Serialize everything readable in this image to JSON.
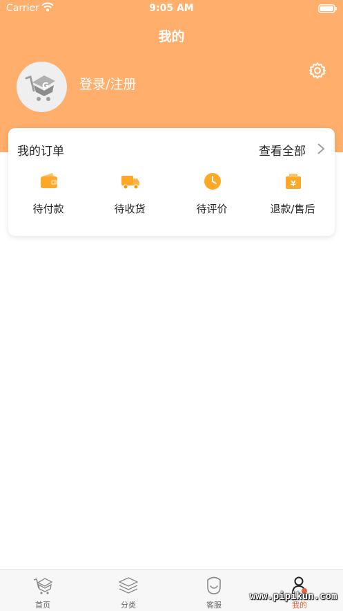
{
  "status_bar": {
    "carrier": "Carrier",
    "time": "9:05 AM",
    "wifi_icon": "wifi-icon",
    "battery_icon": "battery-icon"
  },
  "header": {
    "title": "我的",
    "login_label": "登录/注册",
    "avatar_icon": "logo-cart-icon",
    "settings_icon": "gear-icon"
  },
  "orders": {
    "title": "我的订单",
    "view_all_label": "查看全部",
    "view_all_icon": "chevron-right-icon",
    "items": [
      {
        "label": "待付款",
        "icon": "wallet-icon"
      },
      {
        "label": "待收货",
        "icon": "truck-icon"
      },
      {
        "label": "待评价",
        "icon": "clock-icon"
      },
      {
        "label": "退款/售后",
        "icon": "yen-bag-icon"
      }
    ]
  },
  "tabbar": {
    "items": [
      {
        "label": "首页",
        "icon": "home-logo-icon"
      },
      {
        "label": "分类",
        "icon": "layers-icon"
      },
      {
        "label": "客服",
        "icon": "service-icon"
      },
      {
        "label": "我的",
        "icon": "profile-icon",
        "active": true
      }
    ]
  },
  "watermark": "www.pipikun.com",
  "colors": {
    "header_bg": "#FFAE6B",
    "icon_orange": "#FFA726",
    "active_tab": "#E8613C"
  }
}
